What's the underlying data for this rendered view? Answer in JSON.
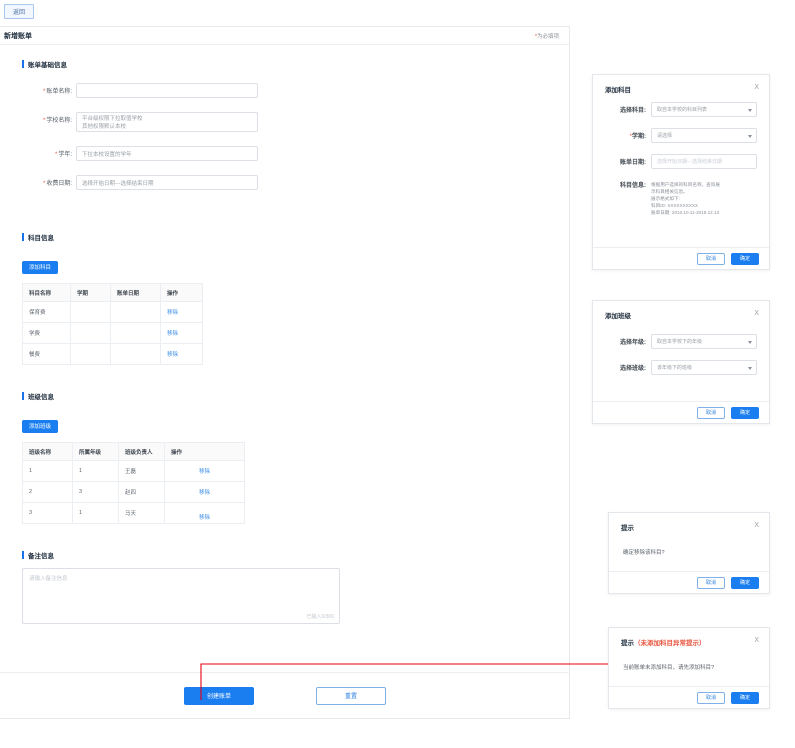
{
  "topbar": {
    "back_label": "返回"
  },
  "card": {
    "title": "新增账单",
    "required_note_star": "*",
    "required_note_text": "为必填项",
    "sections": {
      "basic": {
        "heading": "账单基础信息",
        "fields": [
          {
            "label": "账单名称:",
            "required": true,
            "value": "",
            "placeholder": ""
          },
          {
            "label": "学校名称:",
            "required": true,
            "line1": "平台级权限下拉取值学校",
            "line2": "其他权限默认本校"
          },
          {
            "label": "学年:",
            "required": true,
            "placeholder": "下拉本校设置的学年"
          },
          {
            "label": "收费日期:",
            "required": true,
            "placeholder": "选择开始日期---选择结束日期"
          }
        ]
      },
      "subject": {
        "heading": "科目信息",
        "add_button": "添加科目",
        "columns": [
          "科目名称",
          "学期",
          "账单日期",
          "操作"
        ],
        "rows": [
          {
            "name": "保育费",
            "term": "",
            "bill_date": "",
            "action": "移除"
          },
          {
            "name": "学费",
            "term": "",
            "bill_date": "",
            "action": "移除"
          },
          {
            "name": "餐费",
            "term": "",
            "bill_date": "",
            "action": "移除"
          }
        ]
      },
      "clazz": {
        "heading": "班级信息",
        "add_button": "添加班级",
        "columns": [
          "班级名称",
          "所属年级",
          "班级负责人",
          "操作"
        ],
        "rows": [
          {
            "name": "1",
            "grade": "1",
            "owner": "王磊",
            "action": "移除"
          },
          {
            "name": "2",
            "grade": "3",
            "owner": "赵四",
            "action": "移除"
          },
          {
            "name": "3",
            "grade": "1",
            "owner": "马天",
            "action": "移除"
          }
        ]
      },
      "remark": {
        "heading": "备注信息",
        "placeholder": "请输入备注信息",
        "counter": "已输入0/300"
      }
    },
    "footer": {
      "primary": "创建账单",
      "secondary": "重置"
    }
  },
  "dialogs": {
    "add_subject": {
      "title": "添加科目",
      "close": "X",
      "rows": [
        {
          "label": "选择科目:",
          "required": false,
          "value": "取自本学校的科目列表",
          "type": "select"
        },
        {
          "label": "学期:",
          "required": true,
          "value": "请选择",
          "type": "select"
        },
        {
          "label": "账单日期:",
          "required": false,
          "value": "选择开始日期---选择结束日期",
          "type": "input"
        }
      ],
      "info_label": "科目信息:",
      "info_lines": [
        "根据用户选择的科目名称，查询展",
        "示科目相关信息。",
        "展示格式如下:",
        "科目ID: XXXXXXXXXX",
        "账单日期: 2010.10.11-2019.12.13"
      ],
      "cancel": "取消",
      "confirm": "确定"
    },
    "add_class": {
      "title": "添加班级",
      "close": "X",
      "rows": [
        {
          "label": "选择年级:",
          "value": "取自本学校下的年级",
          "type": "select"
        },
        {
          "label": "选择班级:",
          "value": "该年级下的班级",
          "type": "select"
        }
      ],
      "cancel": "取消",
      "confirm": "确定"
    },
    "confirm_remove": {
      "title": "提示",
      "close": "X",
      "message": "确定移除该科目?",
      "cancel": "取消",
      "confirm": "确定"
    },
    "no_subject": {
      "title": "提示",
      "title_note": "（未添加科目异常提示）",
      "close": "X",
      "message": "当前账单未添加科目，请先添加科目?",
      "cancel": "取消",
      "confirm": "确定"
    }
  },
  "colors": {
    "primary": "#1a7ef0",
    "link": "#3a8ee6",
    "required": "#e8553e",
    "annotation": "#e60012"
  }
}
